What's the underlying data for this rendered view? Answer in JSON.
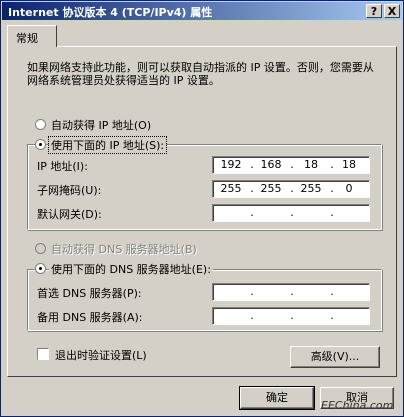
{
  "window": {
    "title": "Internet 协议版本 4 (TCP/IPv4) 属性",
    "help_label": "?",
    "close_label": "X"
  },
  "tabs": [
    {
      "label": "常规"
    }
  ],
  "description": "如果网络支持此功能，则可以获取自动指派的 IP 设置。否则，您需要从网络系统管理员处获得适当的 IP 设置。",
  "ip_mode": {
    "auto_label": "自动获得 IP 地址(O)",
    "manual_label": "使用下面的 IP 地址(S):",
    "selected": "manual"
  },
  "ip_fields": [
    {
      "label": "IP 地址(I):",
      "octets": [
        "192",
        "168",
        "18",
        "18"
      ]
    },
    {
      "label": "子网掩码(U):",
      "octets": [
        "255",
        "255",
        "255",
        "0"
      ]
    },
    {
      "label": "默认网关(D):",
      "octets": [
        "",
        "",
        "",
        ""
      ]
    }
  ],
  "dns_mode": {
    "auto_label": "自动获得 DNS 服务器地址(B)",
    "manual_label": "使用下面的 DNS 服务器地址(E):",
    "selected": "manual"
  },
  "dns_fields": [
    {
      "label": "首选 DNS 服务器(P):",
      "octets": [
        "",
        "",
        "",
        ""
      ]
    },
    {
      "label": "备用 DNS 服务器(A):",
      "octets": [
        "",
        "",
        "",
        ""
      ]
    }
  ],
  "validate_label": "退出时验证设置(L)",
  "advanced_label": "高级(V)...",
  "ok_label": "确定",
  "cancel_label": "取消",
  "watermark": "EEChina.com"
}
